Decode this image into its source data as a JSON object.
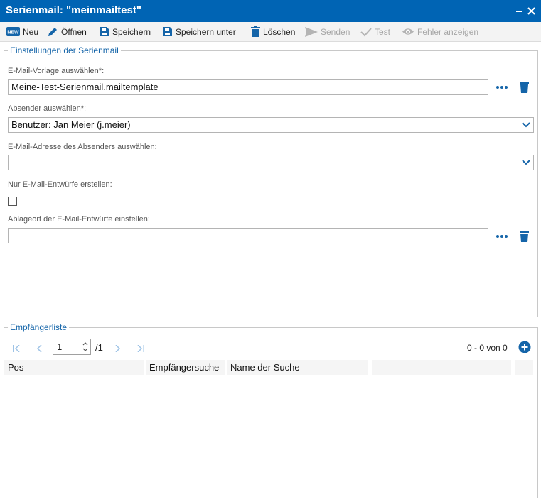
{
  "window": {
    "title": "Serienmail: \"meinmailtest\""
  },
  "toolbar": {
    "new_label": "Neu",
    "open_label": "Öffnen",
    "save_label": "Speichern",
    "save_as_label": "Speichern unter",
    "delete_label": "Löschen",
    "send_label": "Senden",
    "test_label": "Test",
    "show_errors_label": "Fehler anzeigen",
    "new_badge": "NEW"
  },
  "settings": {
    "legend": "Einstellungen der Serienmail",
    "template_label": "E-Mail-Vorlage auswählen*:",
    "template_value": "Meine-Test-Serienmail.mailtemplate",
    "sender_label": "Absender auswählen*:",
    "sender_value": "Benutzer: Jan Meier (j.meier)",
    "sender_email_label": "E-Mail-Adresse des Absenders auswählen:",
    "sender_email_value": "",
    "drafts_only_label": "Nur E-Mail-Entwürfe erstellen:",
    "drafts_only_checked": false,
    "drafts_location_label": "Ablageort der E-Mail-Entwürfe einstellen:",
    "drafts_location_value": ""
  },
  "recipients": {
    "legend": "Empfängerliste",
    "page_value": "1",
    "page_total": "/1",
    "range_text": "0 - 0 von 0",
    "columns": [
      "Pos",
      "Empfängersuche",
      "Name der Suche",
      "",
      ""
    ]
  },
  "colors": {
    "title_bar": "#0064b4",
    "accent": "#1565a9",
    "disabled_text": "#a6a6a6"
  }
}
